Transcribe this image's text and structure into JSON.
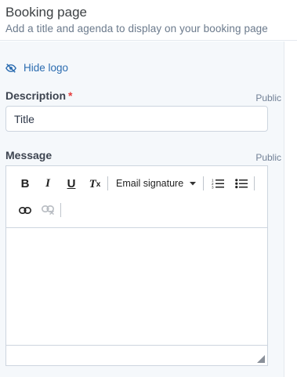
{
  "header": {
    "title": "Booking page",
    "subtitle": "Add a title and agenda to display on your booking page"
  },
  "hide_logo": {
    "label": "Hide logo",
    "icon": "eye-slash-icon"
  },
  "description": {
    "label": "Description",
    "required_mark": "*",
    "visibility": "Public",
    "value": "Title"
  },
  "message": {
    "label": "Message",
    "visibility": "Public",
    "toolbar": {
      "bold": "B",
      "italic": "I",
      "underline": "U",
      "clear_format": "T",
      "clear_format_sub": "x",
      "dropdown_label": "Email signature"
    },
    "content": ""
  },
  "colors": {
    "accent": "#2b6cb0",
    "required": "#e53e3e",
    "panel_bg": "#f5f8fb",
    "border": "#cdd5df"
  }
}
